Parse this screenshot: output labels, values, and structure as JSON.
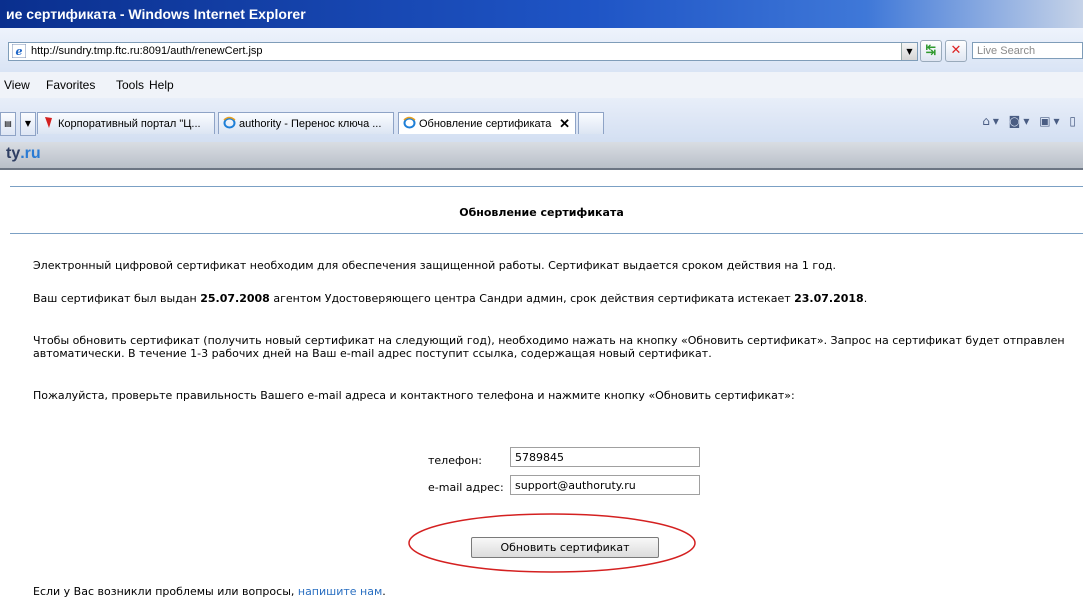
{
  "window": {
    "title": "ие сертификата - Windows Internet Explorer"
  },
  "address": {
    "url": "http://sundry.tmp.ftc.ru:8091/auth/renewCert.jsp",
    "search_placeholder": "Live Search"
  },
  "menu": [
    "View",
    "Favorites",
    "Tools",
    "Help"
  ],
  "tabs": [
    {
      "label": "Корпоративный портал \"Ц...",
      "icon": "bookmark-icon"
    },
    {
      "label": "authority - Перенос ключа ...",
      "icon": "ie-icon"
    },
    {
      "label": "Обновление сертификата",
      "icon": "ie-icon",
      "active": true
    }
  ],
  "site": {
    "logo_prefix": "ty",
    "logo_suffix": ".ru"
  },
  "page": {
    "title": "Обновление сертификата",
    "intro": "Электронный цифровой сертификат необходим для обеспечения защищенной работы. Сертификат выдается сроком действия на 1 год.",
    "issued_prefix": "Ваш сертификат был выдан ",
    "issued_date": "25.07.2008",
    "issued_middle": " агентом Удостоверяющего центра Сандри админ, срок действия сертификата истекает ",
    "expiry_date": "23.07.2018",
    "issued_suffix": ".",
    "instructions": "Чтобы обновить сертификат (получить новый сертификат на следующий год), необходимо нажать на кнопку «Обновить сертификат». Запрос на сертификат будет отправлен автоматически. В течение 1-3 рабочих дней на Ваш e-mail адрес поступит ссылка, содержащая новый сертификат.",
    "check_prompt": "Пожалуйста, проверьте правильность Вашего e-mail адреса и контактного телефона и нажмите кнопку «Обновить сертификат»:"
  },
  "form": {
    "phone_label": "телефон:",
    "phone_value": "5789845",
    "email_label": "e-mail адрес:",
    "email_value": "support@authoruty.ru",
    "submit_label": "Обновить сертификат"
  },
  "footer": {
    "text": "Если у Вас возникли проблемы или вопросы, ",
    "link": "напишите нам",
    "end": "."
  },
  "colors": {
    "highlight_ellipse": "#d42020",
    "link": "#2a6fc1"
  }
}
